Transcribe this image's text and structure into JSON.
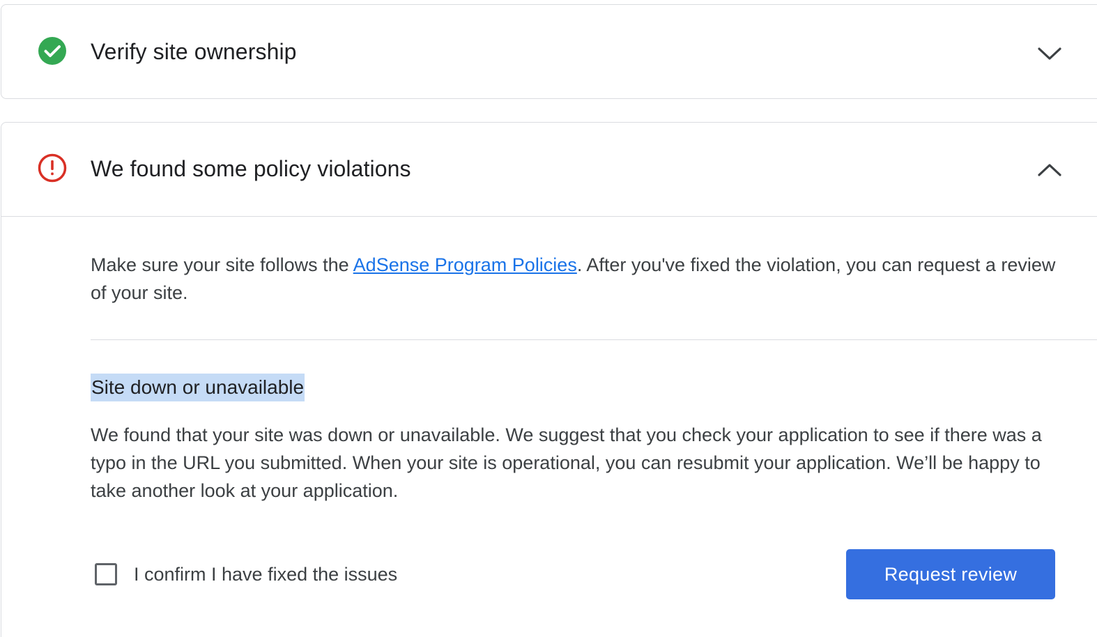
{
  "verify_card": {
    "title": "Verify site ownership",
    "status_icon": "check-circle-icon",
    "status_color": "#34a853",
    "chevron": "chevron-down-icon"
  },
  "policy_card": {
    "title": "We found some policy violations",
    "status_icon": "error-circle-icon",
    "status_color": "#d93025",
    "chevron": "chevron-up-icon",
    "intro_before_link": "Make sure your site follows the ",
    "intro_link": "AdSense Program Policies",
    "intro_after_link": ". After you've fixed the violation, you can request a review of your site.",
    "violation": {
      "title": "Site down or unavailable",
      "description": "We found that your site was down or unavailable. We suggest that you check your application to see if there was a typo in the URL you submitted. When your site is operational, you can resubmit your application. We’ll be happy to take another look at your application."
    },
    "confirm_label": "I confirm I have fixed the issues",
    "confirm_checked": false,
    "request_button_label": "Request review",
    "link_color": "#1a73e8",
    "button_color": "#356fe0",
    "highlight_color": "#c5dbf6"
  }
}
